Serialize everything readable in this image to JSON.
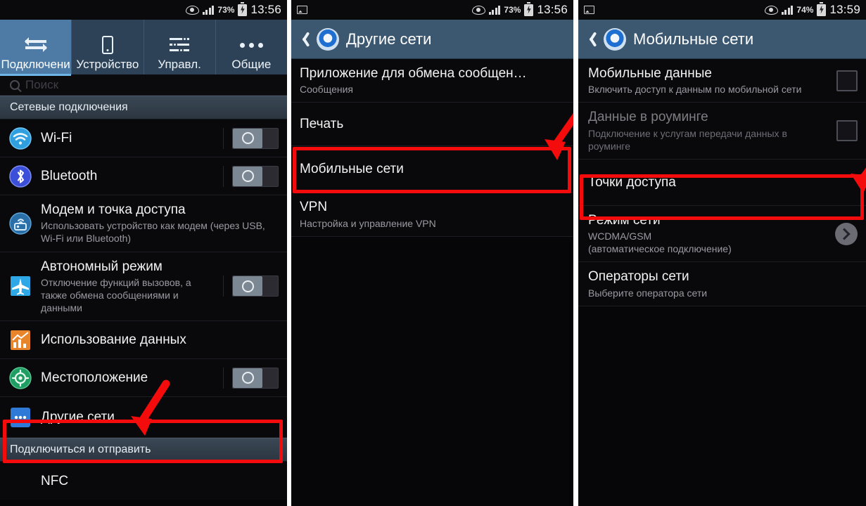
{
  "colors": {
    "accent_blue": "#4d7ba6",
    "appbar_blue": "#3c5770",
    "annotation_red": "#f40b0b",
    "screen_bg": "#09090b"
  },
  "panels": [
    {
      "id": "settings-connections",
      "status_bar": {
        "battery_percent": "73%",
        "time": "13:56",
        "icons": [
          "eye-icon",
          "signal-bars-icon",
          "battery-charging-icon"
        ]
      },
      "tabs": [
        {
          "label": "Подключени",
          "icon": "exchange-arrows-icon",
          "active": true
        },
        {
          "label": "Устройство",
          "icon": "phone-icon",
          "active": false
        },
        {
          "label": "Управл.",
          "icon": "sliders-icon",
          "active": false
        },
        {
          "label": "Общие",
          "icon": "dots-icon",
          "active": false
        }
      ],
      "search": {
        "placeholder": "Поиск",
        "icon": "search-icon"
      },
      "section_header": "Сетевые подключения",
      "rows": [
        {
          "icon": "wifi-icon",
          "title": "Wi-Fi",
          "subtitle": "",
          "control": "toggle",
          "toggle_on": false
        },
        {
          "icon": "bluetooth-icon",
          "title": "Bluetooth",
          "subtitle": "",
          "control": "toggle",
          "toggle_on": false
        },
        {
          "icon": "tethering-hotspot-icon",
          "title": "Модем и точка доступа",
          "subtitle": "Использовать устройство как модем (через USB, Wi-Fi или Bluetooth)",
          "control": "none"
        },
        {
          "icon": "airplane-icon",
          "title": "Автономный режим",
          "subtitle": "Отключение функций вызовов, а также обмена сообщениями и данными",
          "control": "toggle",
          "toggle_on": false
        },
        {
          "icon": "data-usage-icon",
          "title": "Использование данных",
          "subtitle": "",
          "control": "none"
        },
        {
          "icon": "location-icon",
          "title": "Местоположение",
          "subtitle": "",
          "control": "toggle",
          "toggle_on": false
        },
        {
          "icon": "more-networks-icon",
          "title": "Другие сети",
          "subtitle": "",
          "control": "none",
          "highlighted": true
        }
      ],
      "section_header_2": "Подключиться и отправить",
      "rows_2": [
        {
          "icon": "",
          "title": "NFC",
          "subtitle": "",
          "control": "none"
        }
      ]
    },
    {
      "id": "other-networks",
      "status_bar": {
        "battery_percent": "73%",
        "time": "13:56",
        "icons": [
          "image-icon",
          "eye-icon",
          "signal-bars-icon",
          "battery-charging-icon"
        ]
      },
      "appbar": {
        "title": "Другие сети",
        "back_icon": "back-arrow-icon",
        "app_icon": "settings-gear-icon"
      },
      "rows": [
        {
          "title": "Приложение для обмена сообщен…",
          "subtitle": "Сообщения",
          "control": "none"
        },
        {
          "title": "Печать",
          "subtitle": "",
          "control": "none"
        },
        {
          "title": "Мобильные сети",
          "subtitle": "",
          "control": "none",
          "highlighted": true
        },
        {
          "title": "VPN",
          "subtitle": "Настройка и управление VPN",
          "control": "none"
        }
      ]
    },
    {
      "id": "mobile-networks",
      "status_bar": {
        "battery_percent": "74%",
        "time": "13:59",
        "icons": [
          "image-icon",
          "eye-icon",
          "signal-bars-icon",
          "battery-charging-icon"
        ]
      },
      "appbar": {
        "title": "Мобильные сети",
        "back_icon": "back-arrow-icon",
        "app_icon": "settings-gear-icon"
      },
      "rows": [
        {
          "title": "Мобильные данные",
          "subtitle": "Включить доступ к данным по мобильной сети",
          "control": "checkbox",
          "checked": false,
          "disabled": false
        },
        {
          "title": "Данные в роуминге",
          "subtitle": "Подключение к услугам передачи данных в роуминге",
          "control": "checkbox",
          "checked": false,
          "disabled": true
        },
        {
          "title": "Точки доступа",
          "subtitle": "",
          "control": "none",
          "highlighted": true
        },
        {
          "title": "Режим сети",
          "subtitle": "WCDMA/GSM\n(автоматическое подключение)",
          "control": "chevron"
        },
        {
          "title": "Операторы сети",
          "subtitle": "Выберите оператора сети",
          "control": "none"
        }
      ]
    }
  ],
  "annotations": [
    {
      "type": "arrow",
      "target": "Другие сети"
    },
    {
      "type": "box",
      "target": "Другие сети"
    },
    {
      "type": "arrow",
      "target": "Мобильные сети"
    },
    {
      "type": "box",
      "target": "Мобильные сети"
    },
    {
      "type": "arrow",
      "target": "Точки доступа"
    },
    {
      "type": "box",
      "target": "Точки доступа"
    }
  ]
}
